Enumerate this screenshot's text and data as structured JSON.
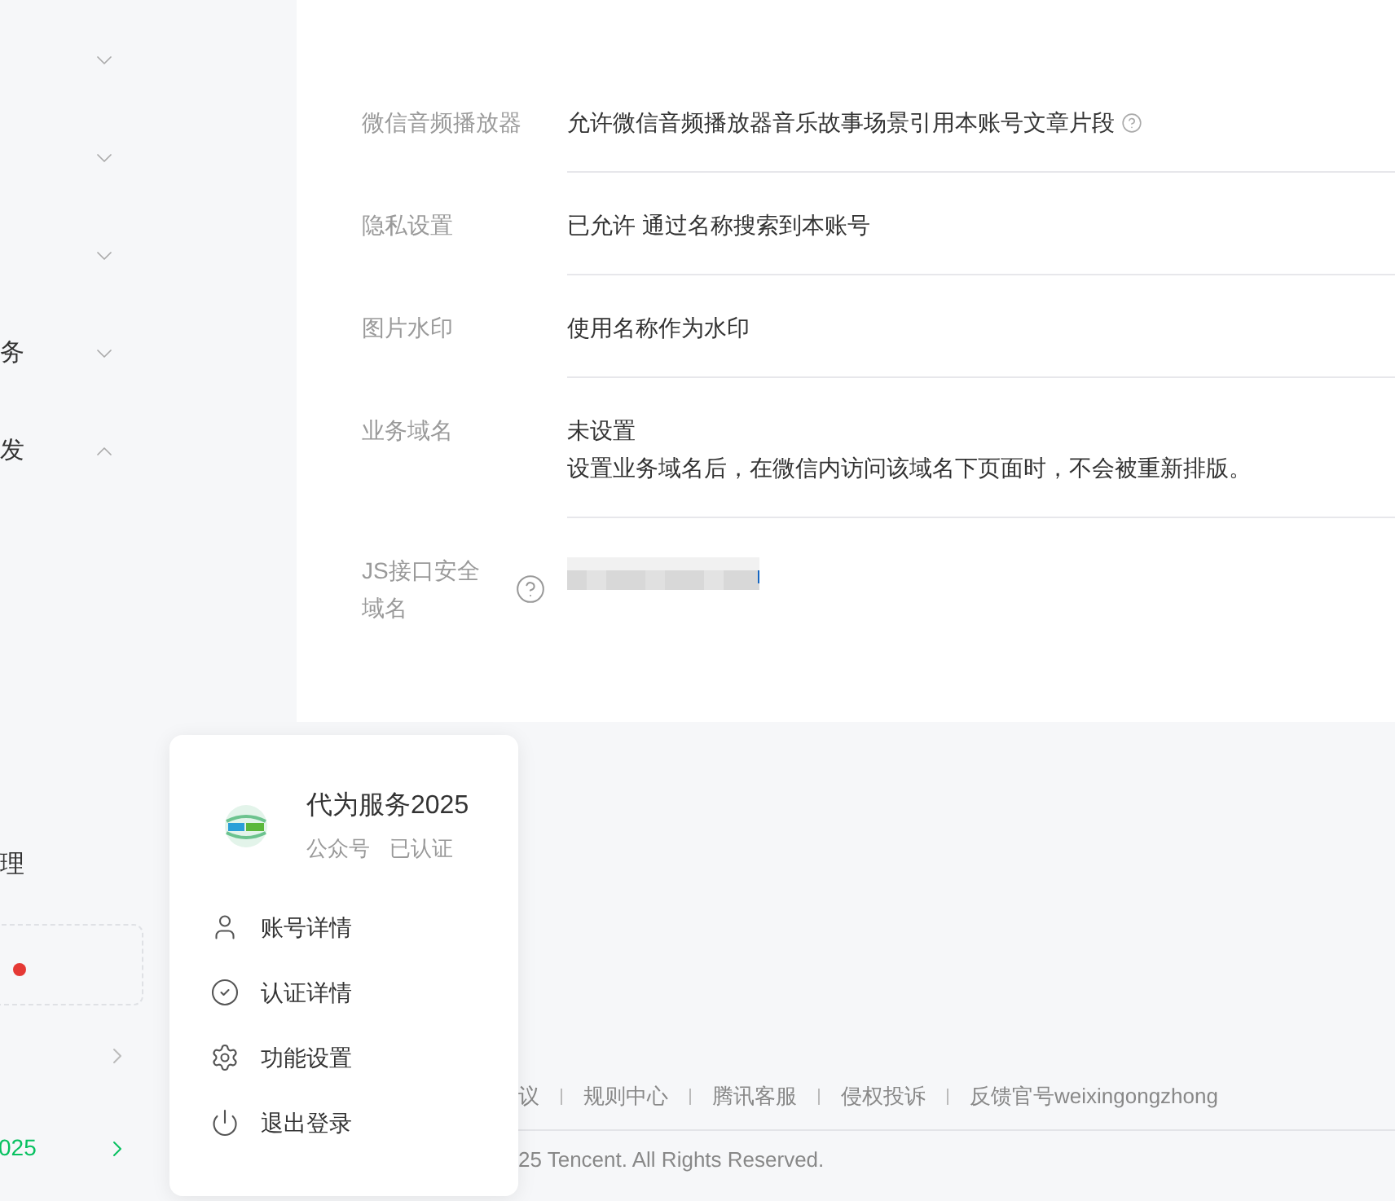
{
  "sidebar": {
    "items": [
      {
        "expanded": false
      },
      {
        "expanded": false
      },
      {
        "expanded": false
      },
      {
        "label": "务",
        "expanded": false
      },
      {
        "label": "发",
        "expanded": true
      }
    ],
    "partial_label": "理",
    "notice_card": {
      "unread": true
    },
    "bottom_items": [
      {
        "selected": false
      },
      {
        "label": "025",
        "selected": true
      }
    ]
  },
  "settings": [
    {
      "label": "微信音频播放器",
      "label_help": false,
      "lines": [
        "允许微信音频播放器音乐故事场景引用本账号文章片段"
      ],
      "value_help": true,
      "kind": "text"
    },
    {
      "label": "隐私设置",
      "label_help": false,
      "lines": [
        "已允许 通过名称搜索到本账号"
      ],
      "value_help": false,
      "kind": "text"
    },
    {
      "label": "图片水印",
      "label_help": false,
      "lines": [
        "使用名称作为水印"
      ],
      "value_help": false,
      "kind": "text"
    },
    {
      "label": "业务域名",
      "label_help": false,
      "lines": [
        "未设置",
        "设置业务域名后，在微信内访问该域名下页面时，不会被重新排版。"
      ],
      "value_help": false,
      "kind": "text"
    },
    {
      "label": "JS接口安全域名",
      "label_help": true,
      "value_help": false,
      "kind": "blurred"
    }
  ],
  "footer": {
    "links": [
      "议",
      "规则中心",
      "腾讯客服",
      "侵权投诉",
      "反馈官号weixingongzhong"
    ],
    "copyright": "25 Tencent. All Rights Reserved."
  },
  "account_popup": {
    "name": "代为服务2025",
    "type": "公众号",
    "status": "已认证",
    "menu": [
      {
        "label": "账号详情"
      },
      {
        "label": "认证详情"
      },
      {
        "label": "功能设置"
      },
      {
        "label": "退出登录"
      }
    ]
  }
}
